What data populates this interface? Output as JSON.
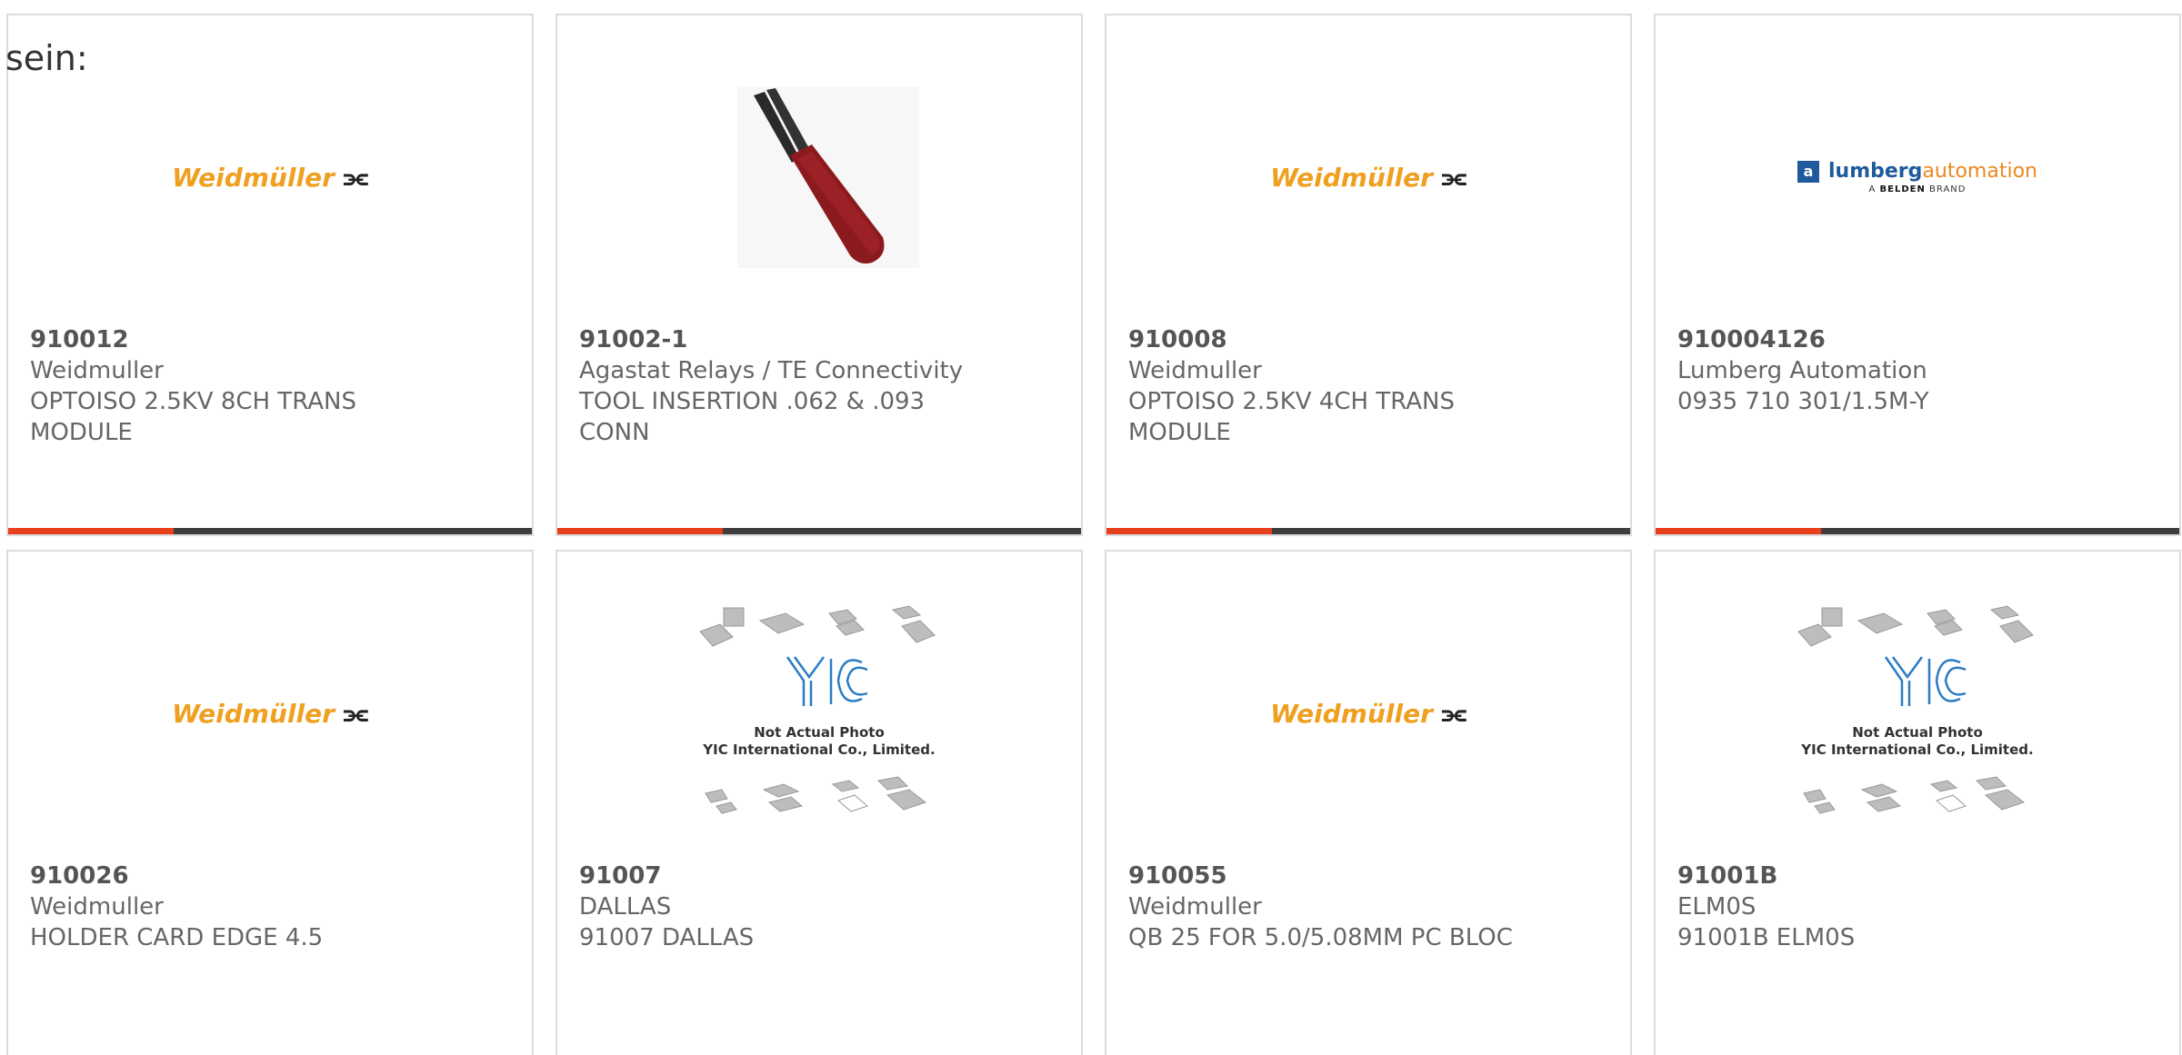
{
  "overlay": {
    "text": "sein:"
  },
  "colors": {
    "accent": "#e8401c",
    "bar": "#3e3e3e",
    "weidmuller": "#f0a020",
    "lumberg_blue": "#1e5a9c",
    "lumberg_orange": "#e98a1f"
  },
  "products": [
    {
      "part_number": "910012",
      "manufacturer": "Weidmuller",
      "description": "OPTOISO 2.5KV 8CH TRANS",
      "description2": "MODULE",
      "image": "weidmuller-logo"
    },
    {
      "part_number": "91002-1",
      "manufacturer": "Agastat Relays / TE Connectivity",
      "description": "TOOL INSERTION .062 & .093",
      "description2": "CONN",
      "image": "insertion-tool-photo"
    },
    {
      "part_number": "910008",
      "manufacturer": "Weidmuller",
      "description": "OPTOISO 2.5KV 4CH TRANS",
      "description2": "MODULE",
      "image": "weidmuller-logo"
    },
    {
      "part_number": "910004126",
      "manufacturer": "Lumberg Automation",
      "description": "0935 710 301/1.5M-Y",
      "description2": "",
      "image": "lumberg-logo"
    },
    {
      "part_number": "910026",
      "manufacturer": "Weidmuller",
      "description": "HOLDER CARD EDGE 4.5",
      "description2": "",
      "image": "weidmuller-logo"
    },
    {
      "part_number": "91007",
      "manufacturer": "DALLAS",
      "description": "91007 DALLAS",
      "description2": "",
      "image": "yic-placeholder"
    },
    {
      "part_number": "910055",
      "manufacturer": "Weidmuller",
      "description": "QB 25 FOR 5.0/5.08MM PC BLOC",
      "description2": "",
      "image": "weidmuller-logo"
    },
    {
      "part_number": "91001B",
      "manufacturer": "ELM0S",
      "description": "91001B ELM0S",
      "description2": "",
      "image": "yic-placeholder"
    }
  ],
  "logos": {
    "weidmuller": "Weidmüller",
    "lumberg_name": "lumberg",
    "lumberg_auto": "automation",
    "lumberg_sub_prefix": "A",
    "lumberg_sub_brand": "BELDEN",
    "lumberg_sub_suffix": "BRAND",
    "yic_line1": "Not Actual Photo",
    "yic_line2": "YIC International Co., Limited."
  }
}
